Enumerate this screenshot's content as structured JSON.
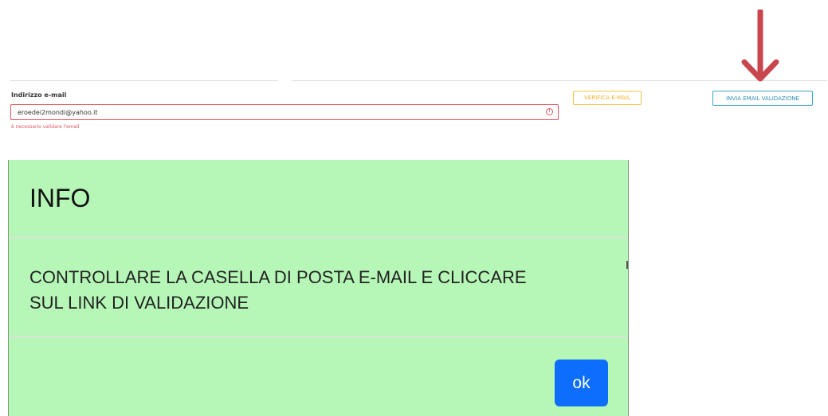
{
  "form": {
    "email_label": "Indirizzo e-mail",
    "email_value": "eroedei2mondi@yahoo.it",
    "error_message": "è necessario validare l'email",
    "invalid_icon_glyph": "!"
  },
  "buttons": {
    "verify_label": "VERIFICA E-MAIL",
    "send_validation_label": "INVIA EMAIL VALIDAZIONE"
  },
  "annotation": {
    "arrow_color": "#c8474f"
  },
  "modal": {
    "title": "INFO",
    "message_line_1": "CONTROLLARE LA CASELLA DI POSTA E-MAIL E CLICCARE",
    "message_line_2": "SUL LINK DI VALIDAZIONE",
    "ok_label": "ok",
    "background_color": "#b6f7b7",
    "button_color": "#0d6efd"
  }
}
